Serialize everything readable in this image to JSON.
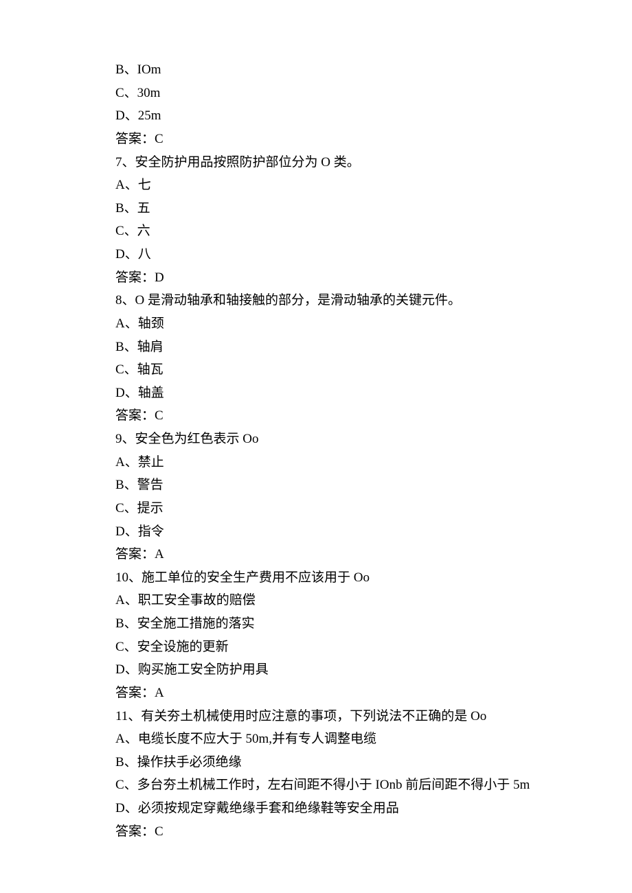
{
  "lines": [
    "B、IOm",
    "C、30m",
    "D、25m",
    "答案：C",
    "7、安全防护用品按照防护部位分为 O 类。",
    "A、七",
    "B、五",
    "C、六",
    "D、八",
    "答案：D",
    "8、O 是滑动轴承和轴接触的部分，是滑动轴承的关键元件。",
    "A、轴颈",
    "B、轴肩",
    "C、轴瓦",
    "D、轴盖",
    "答案：C",
    "9、安全色为红色表示 Oo",
    "A、禁止",
    "B、警告",
    "C、提示",
    "D、指令",
    "答案：A",
    "10、施工单位的安全生产费用不应该用于 Oo",
    "A、职工安全事故的赔偿",
    "B、安全施工措施的落实",
    "C、安全设施的更新",
    "D、购买施工安全防护用具",
    "答案：A",
    "11、有关夯土机械使用时应注意的事项，下列说法不正确的是 Oo",
    "A、电缆长度不应大于 50m,并有专人调整电缆",
    "B、操作扶手必须绝缘",
    "C、多台夯土机械工作时，左右间距不得小于 IOnb 前后间距不得小于 5m",
    "D、必须按规定穿戴绝缘手套和绝缘鞋等安全用品",
    "答案：C"
  ]
}
